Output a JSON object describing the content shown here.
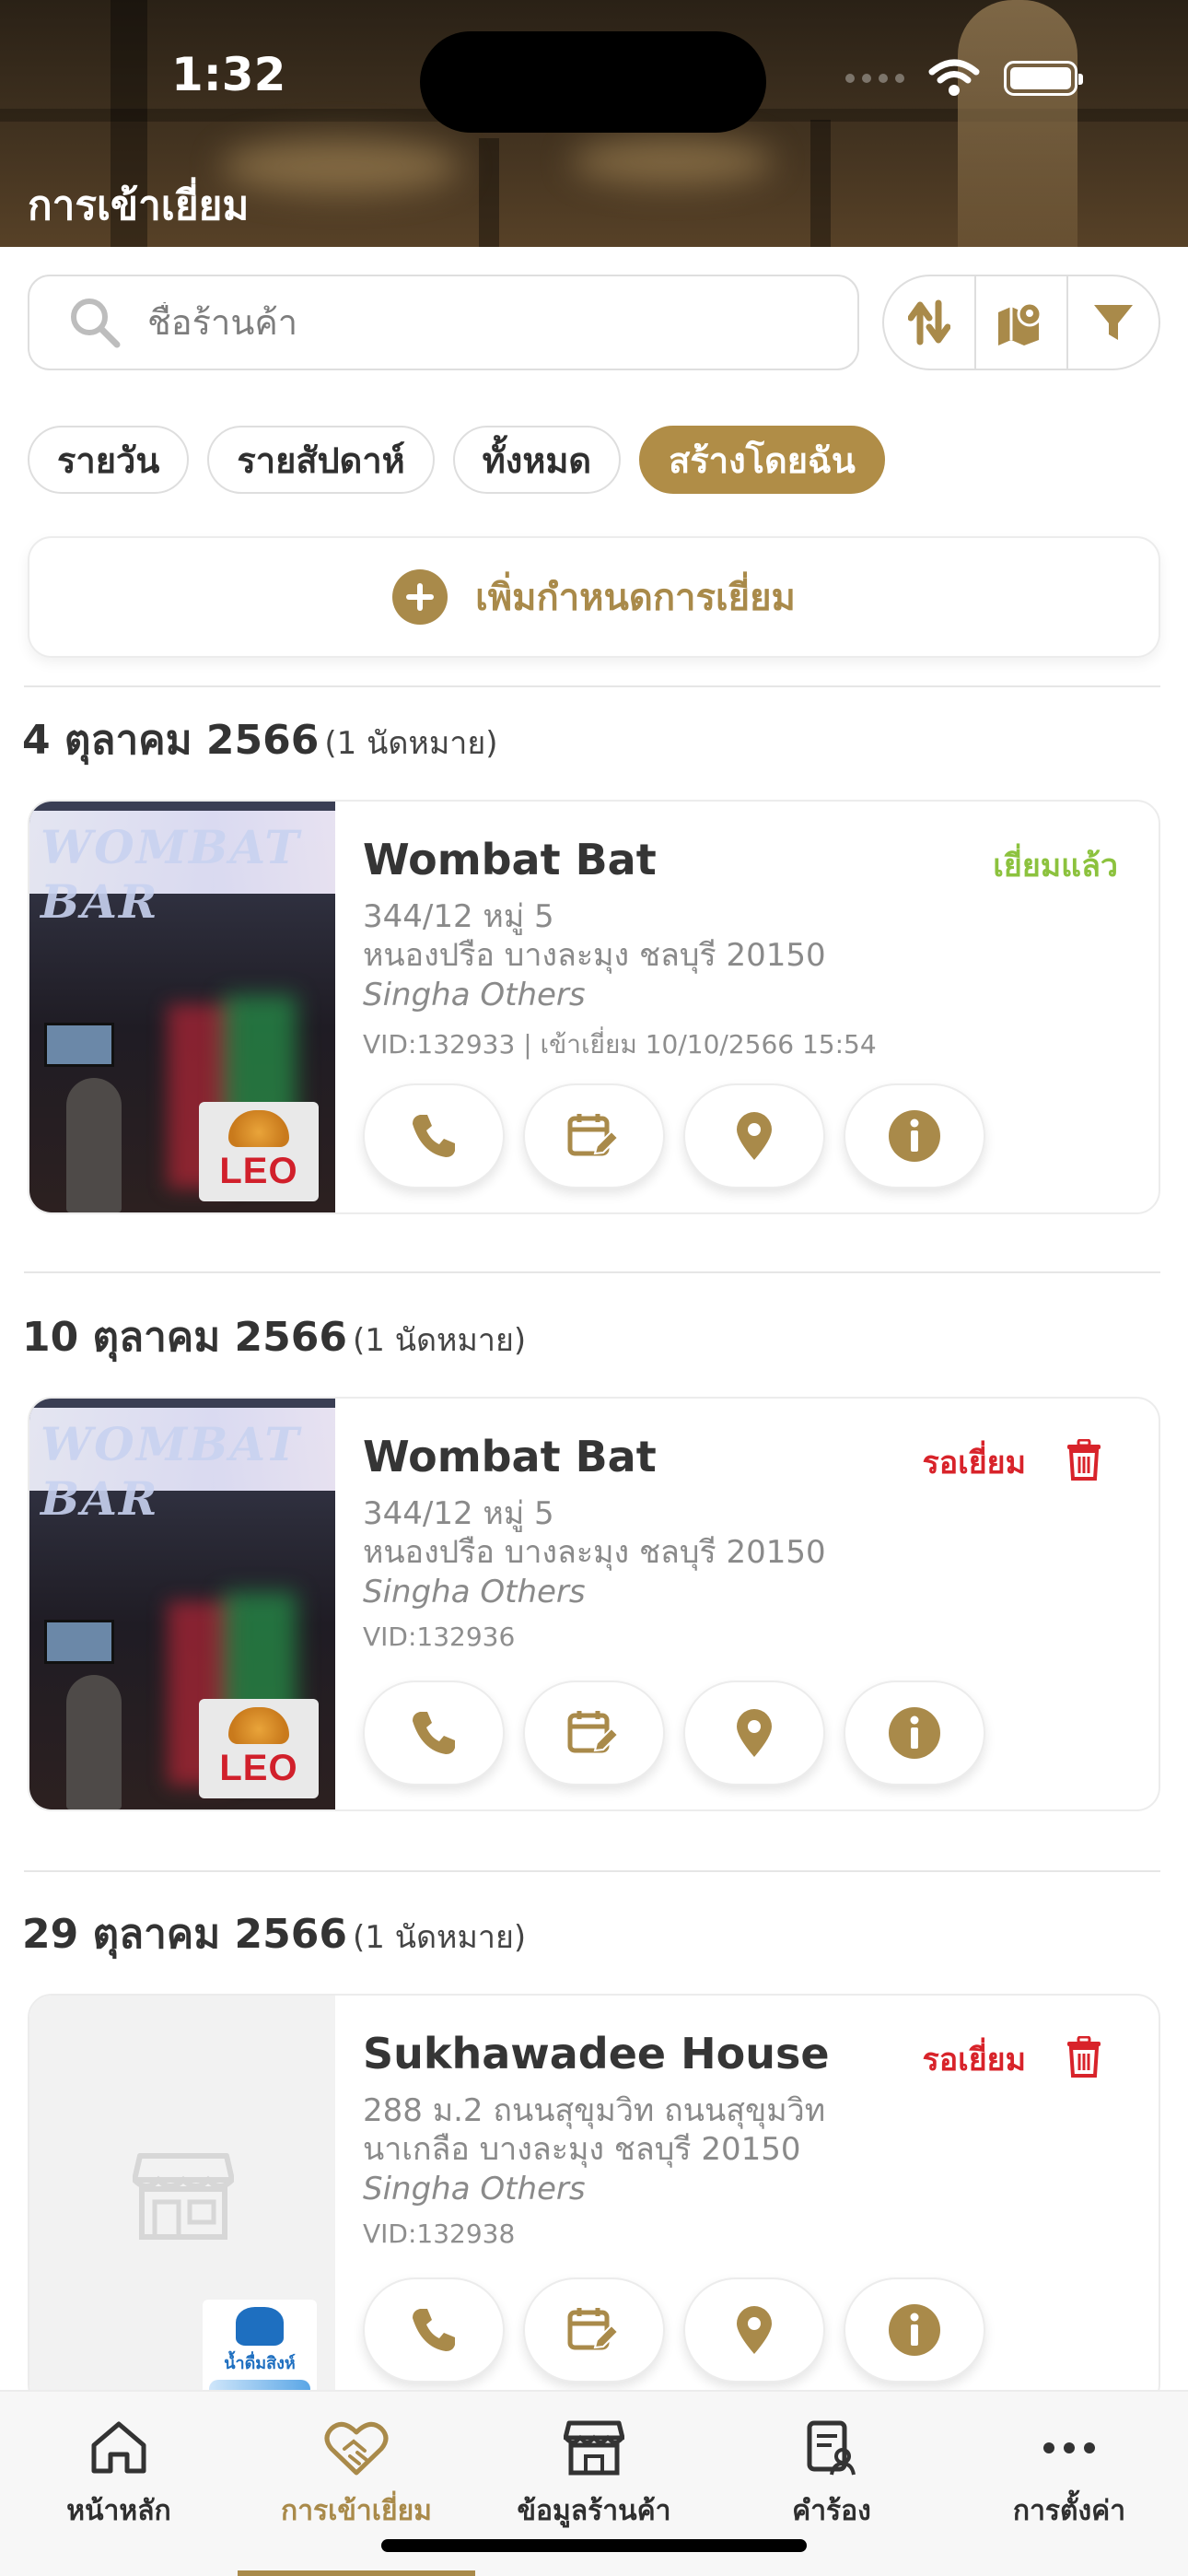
{
  "status_bar": {
    "time": "1:32"
  },
  "header": {
    "title": "การเข้าเยี่ยม"
  },
  "search": {
    "placeholder": "ชื่อร้านค้า"
  },
  "toolbar": {
    "sort_icon": "sort-arrows-icon",
    "map_icon": "map-icon",
    "filter_icon": "filter-funnel-icon"
  },
  "filters": [
    {
      "label": "รายวัน",
      "active": false
    },
    {
      "label": "รายสัปดาห์",
      "active": false
    },
    {
      "label": "ทั้งหมด",
      "active": false
    },
    {
      "label": "สร้างโดยฉัน",
      "active": true
    }
  ],
  "add_button": {
    "label": "เพิ่มกำหนดการเยี่ยม"
  },
  "groups": [
    {
      "date": "4 ตุลาคม 2566",
      "count": "(1 นัดหมาย)",
      "visit": {
        "name": "Wombat Bat",
        "status": "เยี่ยมแล้ว",
        "address_line1": "344/12 หมู่ 5",
        "address_line2": "หนองปรือ บางละมุง ชลบุรี 20150",
        "brand": "Singha Others",
        "vid": "VID:132933 | เข้าเยี่ยม 10/10/2566 15:54",
        "image_text": "WOMBAT BAR",
        "logo_text": "LEO"
      }
    },
    {
      "date": "10 ตุลาคม 2566",
      "count": "(1 นัดหมาย)",
      "visit": {
        "name": "Wombat Bat",
        "status": "รอเยี่ยม",
        "address_line1": "344/12 หมู่ 5",
        "address_line2": "หนองปรือ บางละมุง ชลบุรี 20150",
        "brand": "Singha Others",
        "vid": "VID:132936",
        "image_text": "WOMBAT BAR",
        "logo_text": "LEO"
      }
    },
    {
      "date": "29 ตุลาคม 2566",
      "count": "(1 นัดหมาย)",
      "visit": {
        "name": "Sukhawadee House",
        "status": "รอเยี่ยม",
        "address_line1": "288 ม.2 ถนนสุขุมวิท ถนนสุขุมวิท",
        "address_line2": "นาเกลือ บางละมุง ชลบุรี 20150",
        "brand": "Singha Others",
        "vid": "VID:132938",
        "logo_text": "น้ำดื่มสิงห์"
      }
    }
  ],
  "colors": {
    "accent": "#a98a4a",
    "done": "#8cc23e",
    "wait": "#d8232a"
  },
  "tabs": [
    {
      "label": "หน้าหลัก",
      "icon": "home-icon"
    },
    {
      "label": "การเข้าเยี่ยม",
      "icon": "handshake-heart-icon",
      "active": true
    },
    {
      "label": "ข้อมูลร้านค้า",
      "icon": "store-icon"
    },
    {
      "label": "คำร้อง",
      "icon": "request-document-icon"
    },
    {
      "label": "การตั้งค่า",
      "icon": "more-dots-icon"
    }
  ]
}
